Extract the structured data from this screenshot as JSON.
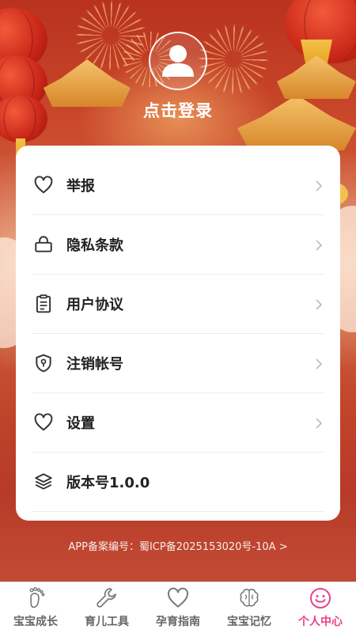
{
  "header": {
    "login_label": "点击登录",
    "avatar_icon": "user-icon"
  },
  "menu": {
    "items": [
      {
        "label": "举报",
        "icon": "heart-icon"
      },
      {
        "label": "隐私条款",
        "icon": "lock-icon"
      },
      {
        "label": "用户协议",
        "icon": "clipboard-icon"
      },
      {
        "label": "注销帐号",
        "icon": "shield-icon"
      },
      {
        "label": "设置",
        "icon": "heart-icon"
      },
      {
        "label": "版本号1.0.0",
        "icon": "layers-icon"
      }
    ]
  },
  "footer": {
    "icp": "APP备案编号：蜀ICP备2025153020号-10A >"
  },
  "tabbar": {
    "items": [
      {
        "label": "宝宝成长",
        "icon": "baby-foot-icon"
      },
      {
        "label": "育儿工具",
        "icon": "wrench-icon"
      },
      {
        "label": "孕育指南",
        "icon": "heart-icon"
      },
      {
        "label": "宝宝记忆",
        "icon": "brain-icon"
      },
      {
        "label": "个人中心",
        "icon": "smile-icon"
      }
    ],
    "active_index": 4
  },
  "colors": {
    "accent": "#e8428a",
    "banner_red": "#c1452a",
    "text_dark": "#222222",
    "tab_inactive": "#666666"
  }
}
